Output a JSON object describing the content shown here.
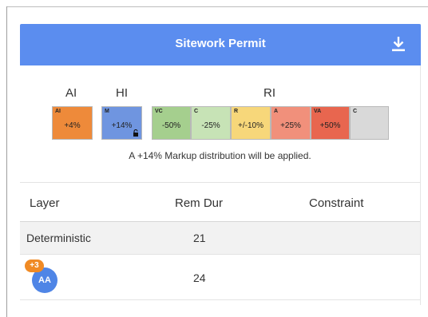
{
  "header": {
    "title": "Sitework Permit",
    "download_icon": "download-icon",
    "color": "#5b8def"
  },
  "groups": {
    "ai_label": "AI",
    "hi_label": "HI",
    "ri_label": "RI"
  },
  "indicators": {
    "ai": {
      "code": "AI",
      "value": "+4%",
      "color": "#ee8a3a"
    },
    "hi": {
      "code": "M",
      "value": "+14%",
      "color": "#6f95e0",
      "icon": "lock-icon"
    },
    "ri": [
      {
        "code": "VC",
        "value": "-50%",
        "color": "#a5cf8e"
      },
      {
        "code": "C",
        "value": "-25%",
        "color": "#c7e3b6"
      },
      {
        "code": "R",
        "value": "+/-10%",
        "color": "#f7d77a"
      },
      {
        "code": "A",
        "value": "+25%",
        "color": "#f1907b"
      },
      {
        "code": "VA",
        "value": "+50%",
        "color": "#e8664f"
      },
      {
        "code": "C",
        "value": "",
        "color": "#d9d9d9"
      }
    ]
  },
  "markup_note": "A +14% Markup distribution will be applied.",
  "table": {
    "columns": [
      "Layer",
      "Rem Dur",
      "Constraint"
    ],
    "rows": [
      {
        "layer": "Deterministic",
        "rem_dur": "21",
        "constraint": ""
      },
      {
        "layer": "",
        "rem_dur": "24",
        "constraint": "",
        "avatar_initials": "AA",
        "avatar_badge": "+3"
      }
    ]
  }
}
